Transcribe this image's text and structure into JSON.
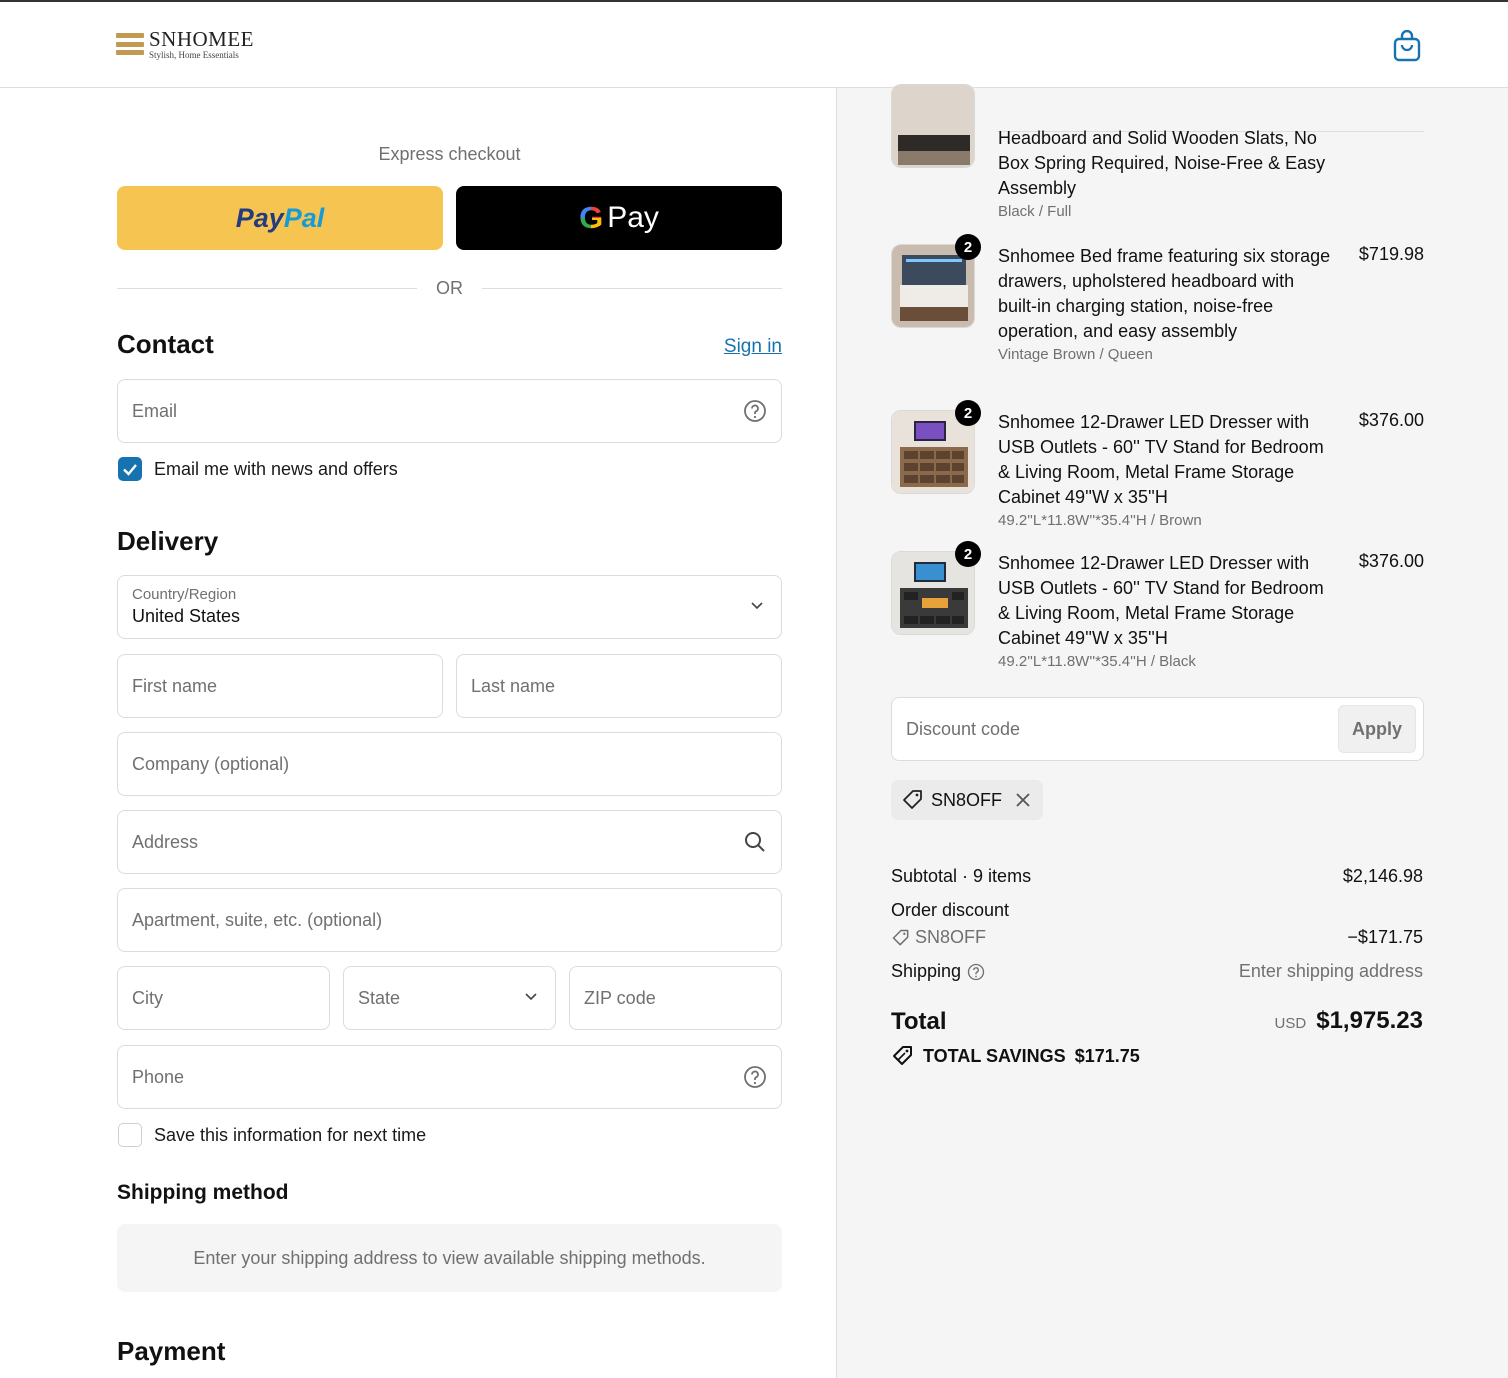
{
  "brand": {
    "name": "SNHOMEE",
    "tagline": "Stylish, Home Essentials"
  },
  "express": {
    "title": "Express checkout",
    "paypal_a": "Pay",
    "paypal_b": "Pal",
    "gpay_g": "G",
    "gpay_label": "Pay",
    "or": "OR"
  },
  "contact": {
    "heading": "Contact",
    "sign_in": "Sign in",
    "email_placeholder": "Email",
    "newsletter_label": "Email me with news and offers",
    "newsletter_checked": true
  },
  "delivery": {
    "heading": "Delivery",
    "country_label": "Country/Region",
    "country_value": "United States",
    "first_name": "First name",
    "last_name": "Last name",
    "company": "Company (optional)",
    "address": "Address",
    "apartment": "Apartment, suite, etc. (optional)",
    "city": "City",
    "state": "State",
    "zip": "ZIP code",
    "phone": "Phone",
    "save_label": "Save this information for next time",
    "save_checked": false
  },
  "shipping_method": {
    "heading": "Shipping method",
    "message": "Enter your shipping address to view available shipping methods."
  },
  "payment": {
    "heading": "Payment"
  },
  "order": {
    "items": [
      {
        "title": "Headboard and Solid Wooden Slats, No Box Spring Required, Noise-Free & Easy Assembly",
        "variant": "Black / Full"
      },
      {
        "qty": "2",
        "title": "Snhomee Bed frame featuring six storage drawers, upholstered headboard with built-in charging station, noise-free operation, and easy assembly",
        "variant": "Vintage Brown / Queen",
        "price": "$719.98"
      },
      {
        "qty": "2",
        "title": "Snhomee 12-Drawer LED Dresser with USB Outlets - 60'' TV Stand for Bedroom & Living Room, Metal Frame Storage Cabinet 49''W x 35''H",
        "variant": "49.2''L*11.8W''*35.4''H / Brown",
        "price": "$376.00"
      },
      {
        "qty": "2",
        "title": "Snhomee 12-Drawer LED Dresser with USB Outlets - 60'' TV Stand for Bedroom & Living Room, Metal Frame Storage Cabinet 49''W x 35''H",
        "variant": "49.2''L*11.8W''*35.4''H / Black",
        "price": "$376.00"
      }
    ],
    "discount_placeholder": "Discount code",
    "apply": "Apply",
    "applied_code": "SN8OFF",
    "subtotal_label": "Subtotal · 9 items",
    "subtotal_value": "$2,146.98",
    "order_discount_label": "Order discount",
    "discount_code": "SN8OFF",
    "discount_value": "−$171.75",
    "shipping_label": "Shipping",
    "shipping_value": "Enter shipping address",
    "total_label": "Total",
    "currency": "USD",
    "total_value": "$1,975.23",
    "savings_label": "TOTAL SAVINGS",
    "savings_value": "$171.75"
  },
  "colors": {
    "accent": "#1773b0",
    "paypal_bg": "#f6c451",
    "summary_bg": "#f5f5f5"
  }
}
